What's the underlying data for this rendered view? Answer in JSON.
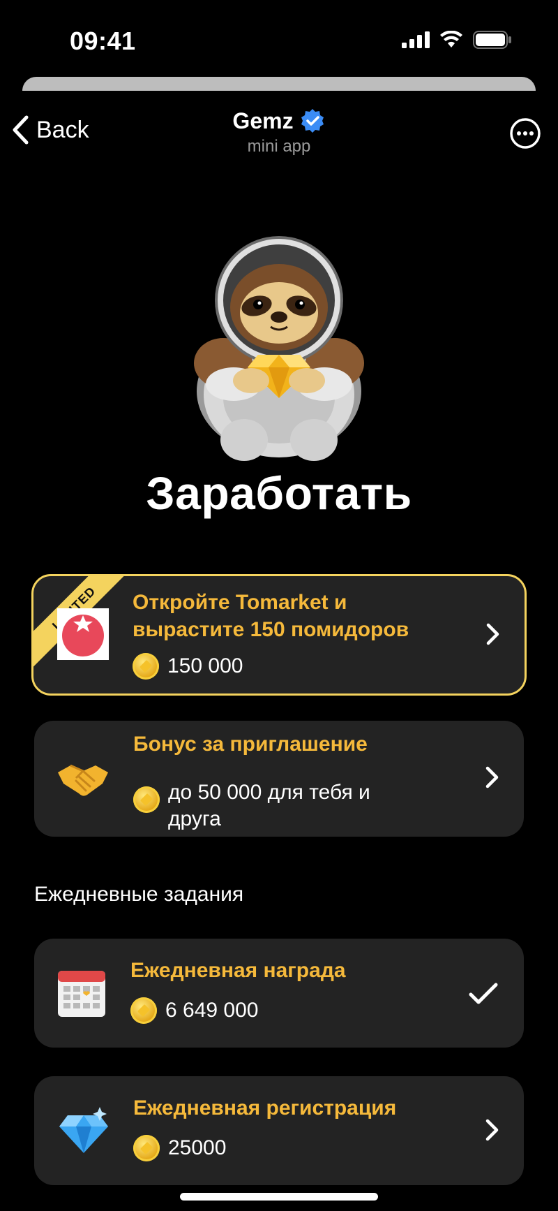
{
  "status_bar": {
    "time": "09:41"
  },
  "nav": {
    "back_label": "Back",
    "app_name": "Gemz",
    "app_subtitle": "mini app"
  },
  "page": {
    "title": "Заработать"
  },
  "promo_card": {
    "badge": "LIMITED",
    "title_line1": "Откройте Tomarket и",
    "title_line2": "вырастите 150 помидоров",
    "reward": "150 000"
  },
  "invite_card": {
    "title": "Бонус за приглашение",
    "reward_line1": "до 50 000 для тебя и",
    "reward_line2": "друга"
  },
  "daily_section": {
    "title": "Ежедневные задания",
    "tasks": [
      {
        "title": "Ежедневная награда",
        "reward": "6 649 000",
        "status_icon": "checkmark-icon"
      },
      {
        "title": "Ежедневная регистрация",
        "reward": "25000",
        "status_icon": "chevron-right-icon"
      }
    ]
  },
  "colors": {
    "background": "#000000",
    "card": "#232323",
    "accent_gold": "#f5b93b",
    "limited_border": "#f4d35e"
  }
}
